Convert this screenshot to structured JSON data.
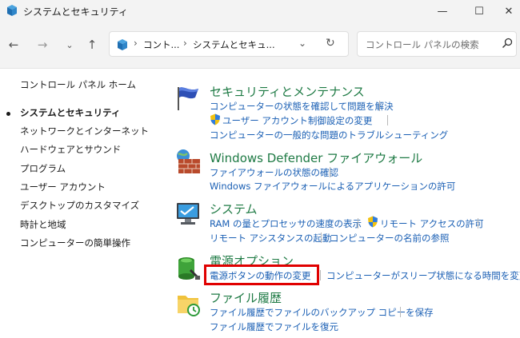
{
  "window": {
    "title": "システムとセキュリティ",
    "minimize_glyph": "—",
    "maximize_glyph": "☐",
    "close_glyph": "✕"
  },
  "nav": {
    "back_glyph": "←",
    "forward_glyph": "→",
    "recent_glyph": "⌄",
    "up_glyph": "↑"
  },
  "address": {
    "breadcrumb_1": "コント...",
    "breadcrumb_2": "システムとセキュ...",
    "separator": "›",
    "dropdown_glyph": "⌄",
    "refresh_glyph": "↻"
  },
  "search": {
    "placeholder": "コントロール パネルの検索"
  },
  "sidebar": {
    "home": "コントロール パネル ホーム",
    "items": [
      {
        "label": "システムとセキュリティ"
      },
      {
        "label": "ネットワークとインターネット"
      },
      {
        "label": "ハードウェアとサウンド"
      },
      {
        "label": "プログラム"
      },
      {
        "label": "ユーザー アカウント"
      },
      {
        "label": "デスクトップのカスタマイズ"
      },
      {
        "label": "時計と地域"
      },
      {
        "label": "コンピューターの簡単操作"
      }
    ]
  },
  "categories": {
    "security": {
      "title": "セキュリティとメンテナンス",
      "icon": "flag-icon",
      "links": [
        "コンピューターの状態を確認して問題を解決",
        "ユーザー アカウント制御設定の変更",
        "コンピューターの一般的な問題のトラブルシューティング"
      ]
    },
    "firewall": {
      "title": "Windows Defender ファイアウォール",
      "icon": "firewall-icon",
      "links": [
        "ファイアウォールの状態の確認",
        "Windows ファイアウォールによるアプリケーションの許可"
      ]
    },
    "system": {
      "title": "システム",
      "icon": "monitor-icon",
      "links": [
        "RAM の量とプロセッサの速度の表示",
        "リモート アクセスの許可",
        "リモート アシスタンスの起動",
        "コンピューターの名前の参照"
      ]
    },
    "power": {
      "title": "電源オプション",
      "icon": "battery-icon",
      "links": [
        "電源ボタンの動作の変更",
        "コンピューターがスリープ状態になる時間を変更"
      ]
    },
    "history": {
      "title": "ファイル履歴",
      "icon": "file-history-icon",
      "links": [
        "ファイル履歴でファイルのバックアップ コピーを保存",
        "ファイル履歴でファイルを復元"
      ]
    }
  },
  "colors": {
    "highlight_box": "#e00000",
    "link": "#1a5fb4",
    "category_title": "#1e7a44"
  }
}
